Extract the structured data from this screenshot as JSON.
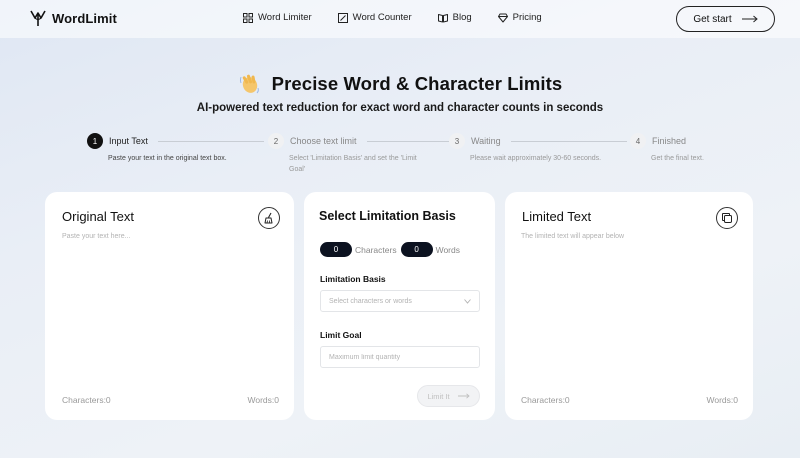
{
  "nav": {
    "brand": "WordLimit",
    "links": [
      {
        "label": "Word Limiter",
        "icon": "grid-icon"
      },
      {
        "label": "Word Counter",
        "icon": "edit-square-icon"
      },
      {
        "label": "Blog",
        "icon": "book-icon"
      },
      {
        "label": "Pricing",
        "icon": "diamond-icon"
      }
    ],
    "cta": "Get start"
  },
  "hero": {
    "title": "Precise Word & Character Limits",
    "subtitle": "AI-powered text reduction for exact word and character counts in seconds"
  },
  "steps": [
    {
      "num": "1",
      "title": "Input Text",
      "desc": "Paste your text in the original text box.",
      "active": true
    },
    {
      "num": "2",
      "title": "Choose text limit",
      "desc": "Select 'Limitation Basis' and set the 'Limit Goal'",
      "active": false
    },
    {
      "num": "3",
      "title": "Waiting",
      "desc": "Please wait approximately 30-60 seconds.",
      "active": false
    },
    {
      "num": "4",
      "title": "Finished",
      "desc": "Get the final text.",
      "active": false
    }
  ],
  "original": {
    "title": "Original Text",
    "placeholder": "Paste your text here...",
    "characters": "Characters:0",
    "words": "Words:0"
  },
  "limitation": {
    "title": "Select Limitation Basis",
    "char_count": "0",
    "char_label": "Characters",
    "word_count": "0",
    "word_label": "Words",
    "basis_label": "Limitation Basis",
    "basis_placeholder": "Select characters or words",
    "goal_label": "Limit Goal",
    "goal_placeholder": "Maximum limit quantity",
    "button": "Limit It"
  },
  "limited": {
    "title": "Limited Text",
    "placeholder": "The limited text will appear below",
    "characters": "Characters:0",
    "words": "Words:0"
  },
  "colors": {
    "accent_dark": "#0c1220",
    "muted_text": "#999999"
  }
}
